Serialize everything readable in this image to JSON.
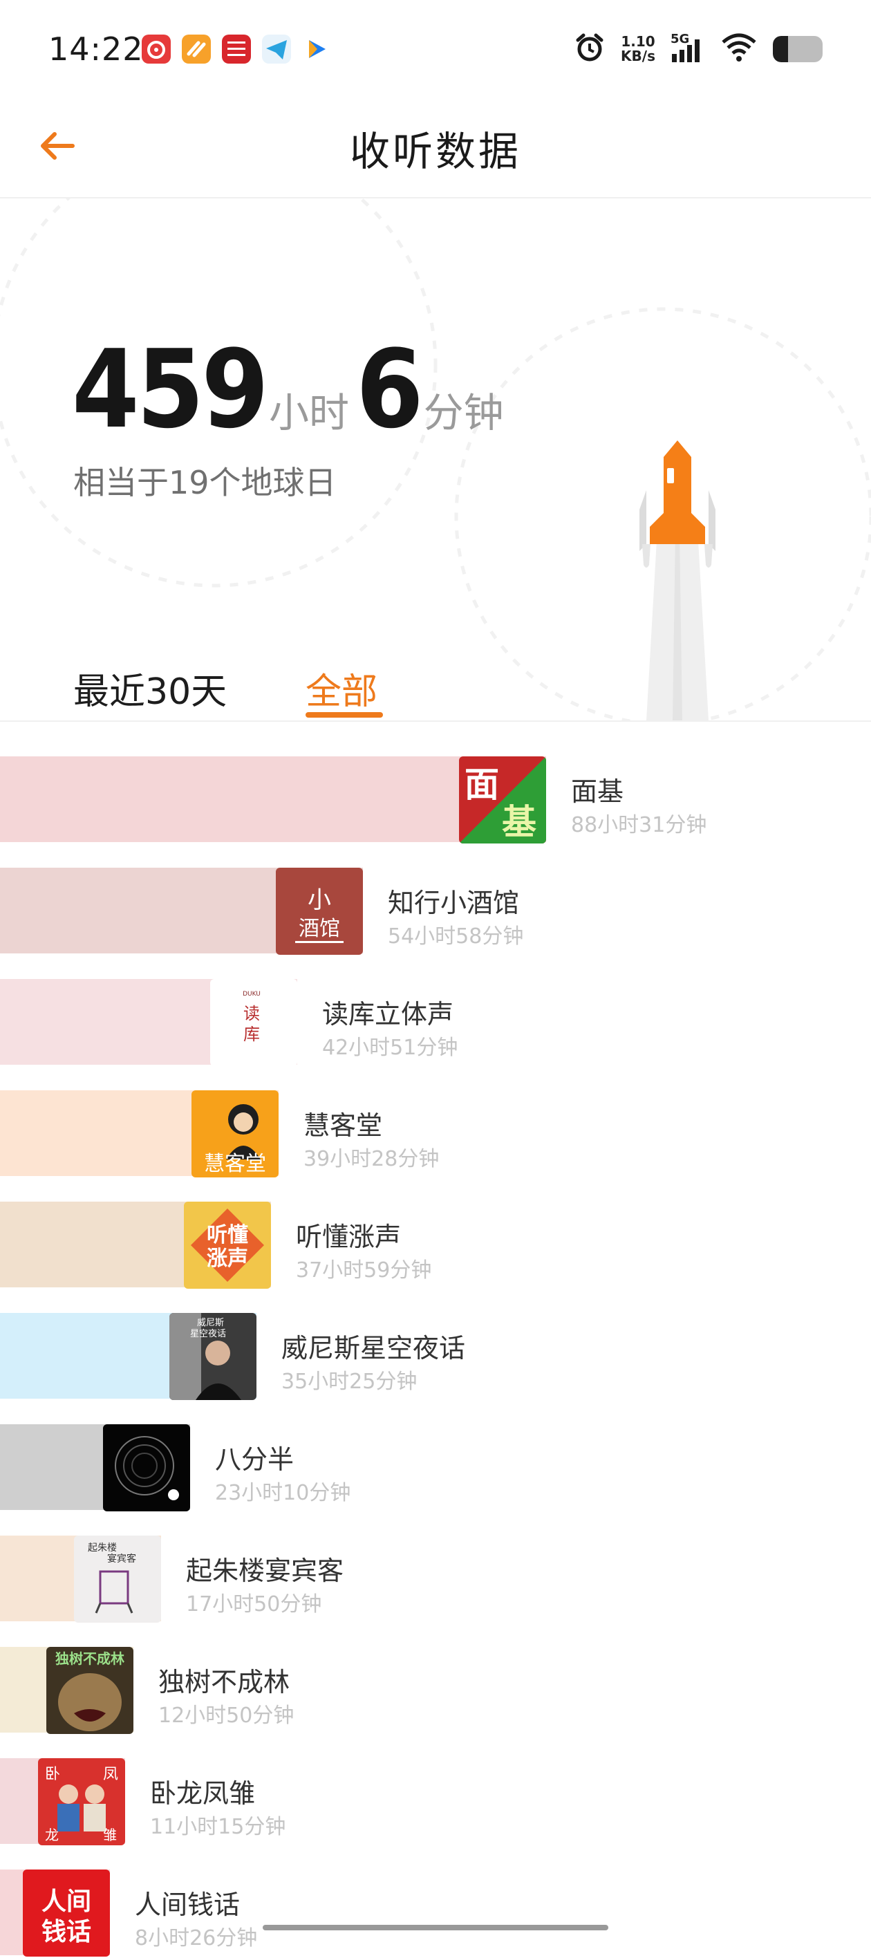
{
  "status_bar": {
    "time": "14:22",
    "net_speed_value": "1.10",
    "net_speed_unit": "KB/s",
    "network_type": "5G",
    "battery_level": 0.3,
    "notification_icons": [
      "netease-music-icon",
      "orange-app-icon",
      "cmb-securities-icon",
      "telegram-icon",
      "play-app-icon"
    ]
  },
  "header": {
    "title": "收听数据"
  },
  "summary": {
    "hours": "459",
    "hours_unit": "小时",
    "minutes": "6",
    "minutes_unit": "分钟",
    "equivalent": "相当于19个地球日"
  },
  "tabs": [
    {
      "label": "最近30天",
      "active": false
    },
    {
      "label": "全部",
      "active": true
    }
  ],
  "colors": {
    "accent": "#ee7a1c",
    "rocket": "#f57f17"
  },
  "ranking": [
    {
      "name": "面基",
      "time": "88小时31分钟",
      "minutes": 5311,
      "bar_color": "#f4d6d7",
      "cover_text": "面基"
    },
    {
      "name": "知行小酒馆",
      "time": "54小时58分钟",
      "minutes": 3298,
      "bar_color": "#ecd4d2",
      "cover_text": "小酒馆"
    },
    {
      "name": "读库立体声",
      "time": "42小时51分钟",
      "minutes": 2571,
      "bar_color": "#f6e0e2",
      "cover_text": "读库"
    },
    {
      "name": "慧客堂",
      "time": "39小时28分钟",
      "minutes": 2368,
      "bar_color": "#fde4d2",
      "cover_text": "慧客堂"
    },
    {
      "name": "听懂涨声",
      "time": "37小时59分钟",
      "minutes": 2279,
      "bar_color": "#f1e0cd",
      "cover_text": "听懂涨声"
    },
    {
      "name": "威尼斯星空夜话",
      "time": "35小时25分钟",
      "minutes": 2125,
      "bar_color": "#d4effb",
      "cover_text": "威尼斯星空夜话"
    },
    {
      "name": "八分半",
      "time": "23小时10分钟",
      "minutes": 1390,
      "bar_color": "#cfcfcf",
      "cover_text": ""
    },
    {
      "name": "起朱楼宴宾客",
      "time": "17小时50分钟",
      "minutes": 1070,
      "bar_color": "#f7e5d5",
      "cover_text": "起朱楼宴宾客"
    },
    {
      "name": "独树不成林",
      "time": "12小时50分钟",
      "minutes": 770,
      "bar_color": "#f4ebd6",
      "cover_text": "独树不成林"
    },
    {
      "name": "卧龙凤雏",
      "time": "11小时15分钟",
      "minutes": 675,
      "bar_color": "#f3d9dc",
      "cover_text": "卧龙凤雏"
    },
    {
      "name": "人间钱话",
      "time": "8小时26分钟",
      "minutes": 506,
      "bar_color": "#f6d6d8",
      "cover_text": "人间钱话"
    }
  ]
}
